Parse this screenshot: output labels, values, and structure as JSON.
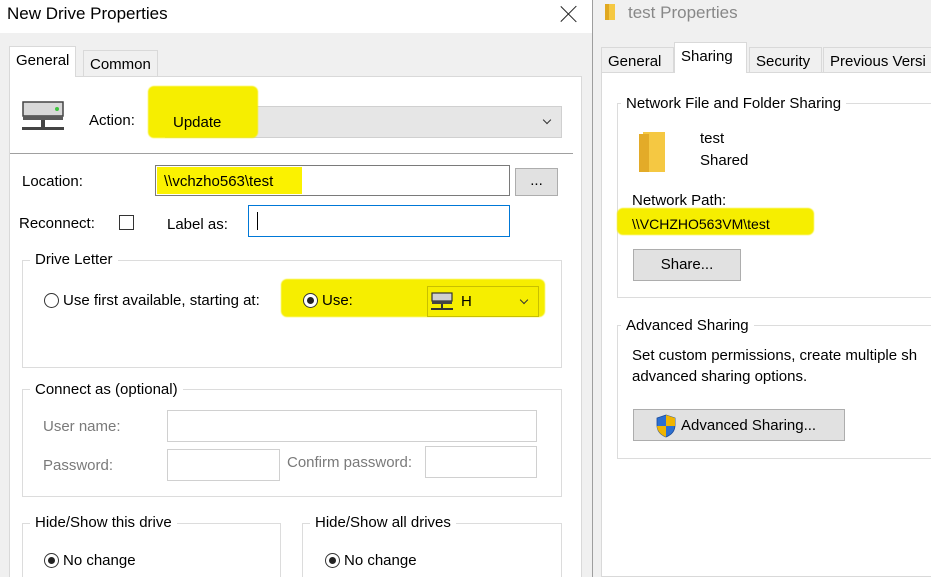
{
  "left": {
    "title": "New Drive Properties",
    "tabs": [
      "General",
      "Common"
    ],
    "action_label": "Action:",
    "action_value": "Update",
    "location_label": "Location:",
    "location_value": "\\\\vchzho563\\test",
    "browse_label": "...",
    "reconnect_label": "Reconnect:",
    "label_as_label": "Label as:",
    "drive_letter_group": "Drive Letter",
    "use_first_label": "Use first available, starting at:",
    "use_label": "Use:",
    "drive_letter_value": "H",
    "connect_as_group": "Connect as (optional)",
    "user_name_label": "User name:",
    "password_label": "Password:",
    "confirm_password_label": "Confirm password:",
    "hide_show_drive_group": "Hide/Show this drive",
    "hide_show_all_group": "Hide/Show all drives",
    "no_change_label": "No change"
  },
  "right": {
    "title": "test Properties",
    "tabs": [
      "General",
      "Sharing",
      "Security",
      "Previous Versi"
    ],
    "network_sharing_group": "Network File and Folder Sharing",
    "folder_name": "test",
    "folder_state": "Shared",
    "network_path_label": "Network Path:",
    "network_path_value": "\\\\VCHZHO563VM\\test",
    "share_button": "Share...",
    "advanced_sharing_group": "Advanced Sharing",
    "advanced_desc_line1": "Set custom permissions, create multiple sh",
    "advanced_desc_line2": "advanced sharing options.",
    "advanced_sharing_button": "Advanced Sharing..."
  },
  "colors": {
    "highlight": "#fbf200",
    "window_bg": "#f0f0f0",
    "folder": "#f5c842",
    "shield_blue": "#2c6fd1",
    "shield_gold": "#f0b400"
  },
  "icons": [
    "network-drive-icon",
    "folder-icon",
    "shield-icon",
    "drive-icon",
    "chevron-down-icon",
    "close-icon"
  ]
}
